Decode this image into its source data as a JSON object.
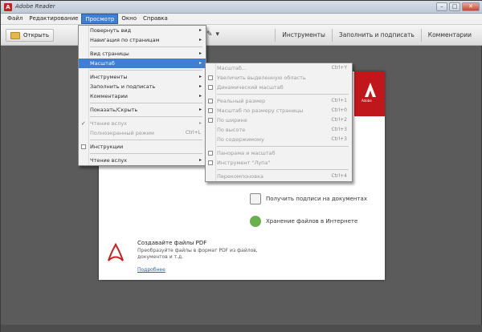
{
  "window": {
    "title": "Adobe Reader",
    "app_icon_glyph": "A",
    "buttons": {
      "minimize": "–",
      "maximize": "□",
      "close": "✕"
    }
  },
  "menubar": {
    "items": [
      {
        "label": "Файл"
      },
      {
        "label": "Редактирование"
      },
      {
        "label": "Просмотр",
        "active": true
      },
      {
        "label": "Окно"
      },
      {
        "label": "Справка"
      }
    ]
  },
  "toolbar": {
    "open_label": "Открыть",
    "right_links": [
      "Инструменты",
      "Заполнить и подписать",
      "Комментарии"
    ]
  },
  "view_menu": {
    "items": [
      {
        "label": "Повернуть вид",
        "arrow": "▸"
      },
      {
        "label": "Навигация по страницам",
        "arrow": "▸"
      },
      {
        "sep": true
      },
      {
        "label": "Вид страницы",
        "arrow": "▸"
      },
      {
        "label": "Масштаб",
        "arrow": "▸",
        "highlight": true
      },
      {
        "sep": true
      },
      {
        "label": "Инструменты",
        "arrow": "▸"
      },
      {
        "label": "Заполнить и подписать",
        "arrow": "▸"
      },
      {
        "label": "Комментарии",
        "arrow": "▸"
      },
      {
        "sep": true
      },
      {
        "label": "Показать/Скрыть",
        "arrow": "▸"
      },
      {
        "sep": true
      },
      {
        "label": "Чтение вслух",
        "arrow": "▸",
        "check": "✓",
        "disabled": true
      },
      {
        "label": "Полноэкранный режим",
        "shortcut": "Ctrl+L",
        "disabled": true
      },
      {
        "sep": true
      },
      {
        "label": "Инструкции",
        "icon": true
      },
      {
        "sep": true
      },
      {
        "label": "Чтение вслух",
        "arrow": "▸"
      }
    ]
  },
  "zoom_menu": {
    "items": [
      {
        "label": "Масштаб...",
        "shortcut": "Ctrl+Y",
        "disabled": true
      },
      {
        "label": "Увеличить выделенную область",
        "icon": true,
        "disabled": true
      },
      {
        "label": "Динамический масштаб",
        "icon": true,
        "disabled": true
      },
      {
        "sep": true
      },
      {
        "label": "Реальный размер",
        "shortcut": "Ctrl+1",
        "icon": true,
        "disabled": true
      },
      {
        "label": "Масштаб по размеру страницы",
        "shortcut": "Ctrl+0",
        "icon": true,
        "disabled": true
      },
      {
        "label": "По ширине",
        "shortcut": "Ctrl+2",
        "icon": true,
        "disabled": true
      },
      {
        "label": "По высоте",
        "shortcut": "Ctrl+3",
        "disabled": true
      },
      {
        "label": "По содержимому",
        "shortcut": "Ctrl+3",
        "disabled": true
      },
      {
        "sep": true
      },
      {
        "label": "Панорама и масштаб",
        "icon": true,
        "disabled": true
      },
      {
        "label": "Инструмент \"Лупа\"",
        "icon": true,
        "disabled": true
      },
      {
        "sep": true
      },
      {
        "label": "Перекомпоновка",
        "shortcut": "Ctrl+4",
        "disabled": true
      }
    ]
  },
  "home": {
    "adobe_tag": "Adobe",
    "actions": [
      {
        "label": "Получить подписи на документах",
        "icon": "sign-icon"
      },
      {
        "label": "Хранение файлов в Интернете",
        "icon": "cloud-icon"
      }
    ],
    "promo": {
      "title": "Создавайте файлы PDF",
      "text": "Преобразуйте файлы в формат PDF из файлов, документов и т.д.",
      "link": "Подробнее"
    }
  }
}
